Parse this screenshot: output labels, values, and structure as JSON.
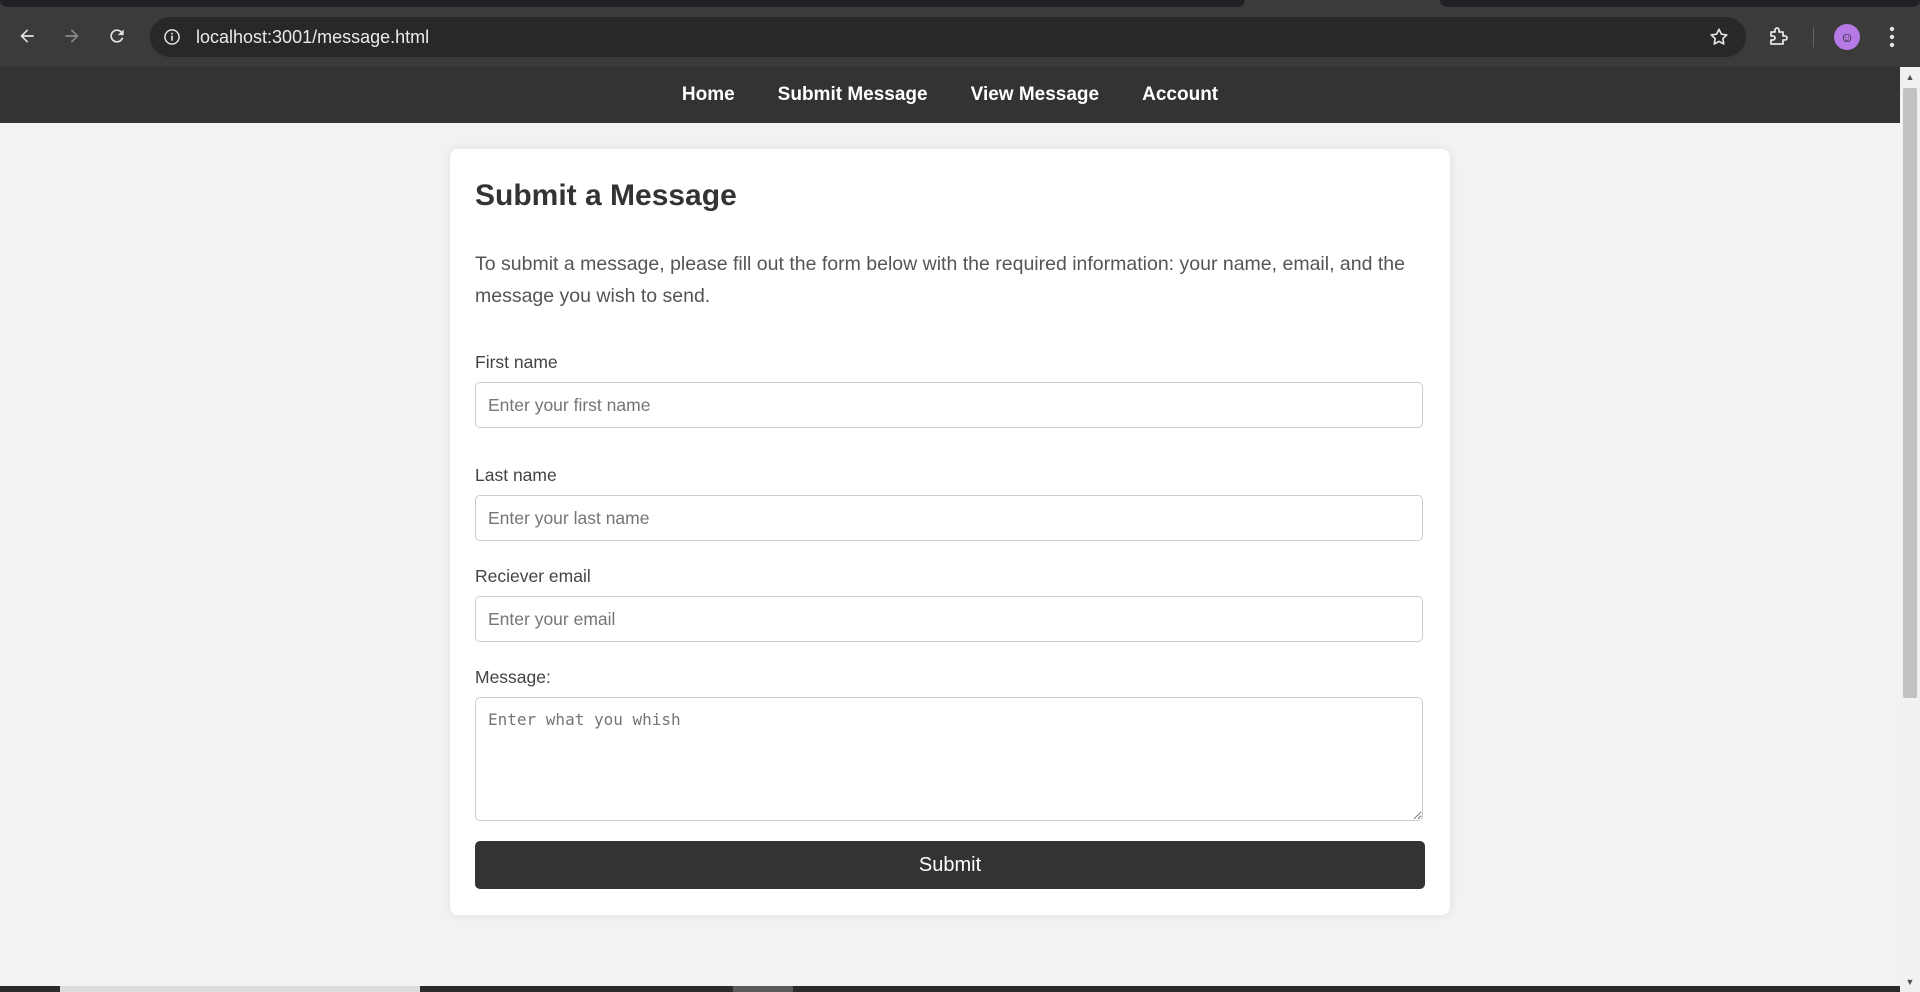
{
  "browser": {
    "url": "localhost:3001/message.html"
  },
  "nav": {
    "items": [
      "Home",
      "Submit Message",
      "View Message",
      "Account"
    ]
  },
  "form": {
    "title": "Submit a Message",
    "intro": "To submit a message, please fill out the form below with the required information: your name, email, and the message you wish to send.",
    "first_name": {
      "label": "First name",
      "placeholder": "Enter your first name"
    },
    "last_name": {
      "label": "Last name",
      "placeholder": "Enter your last name"
    },
    "email": {
      "label": "Reciever email",
      "placeholder": "Enter your email"
    },
    "message": {
      "label": "Message:",
      "placeholder": "Enter what you whish"
    },
    "submit_label": "Submit"
  },
  "colors": {
    "nav_bg": "#333333",
    "page_bg": "#f2f2f2",
    "button_bg": "#333333"
  },
  "icons": [
    "back-icon",
    "forward-icon",
    "reload-icon",
    "info-icon",
    "star-icon",
    "extensions-icon",
    "profile-avatar",
    "menu-icon"
  ]
}
